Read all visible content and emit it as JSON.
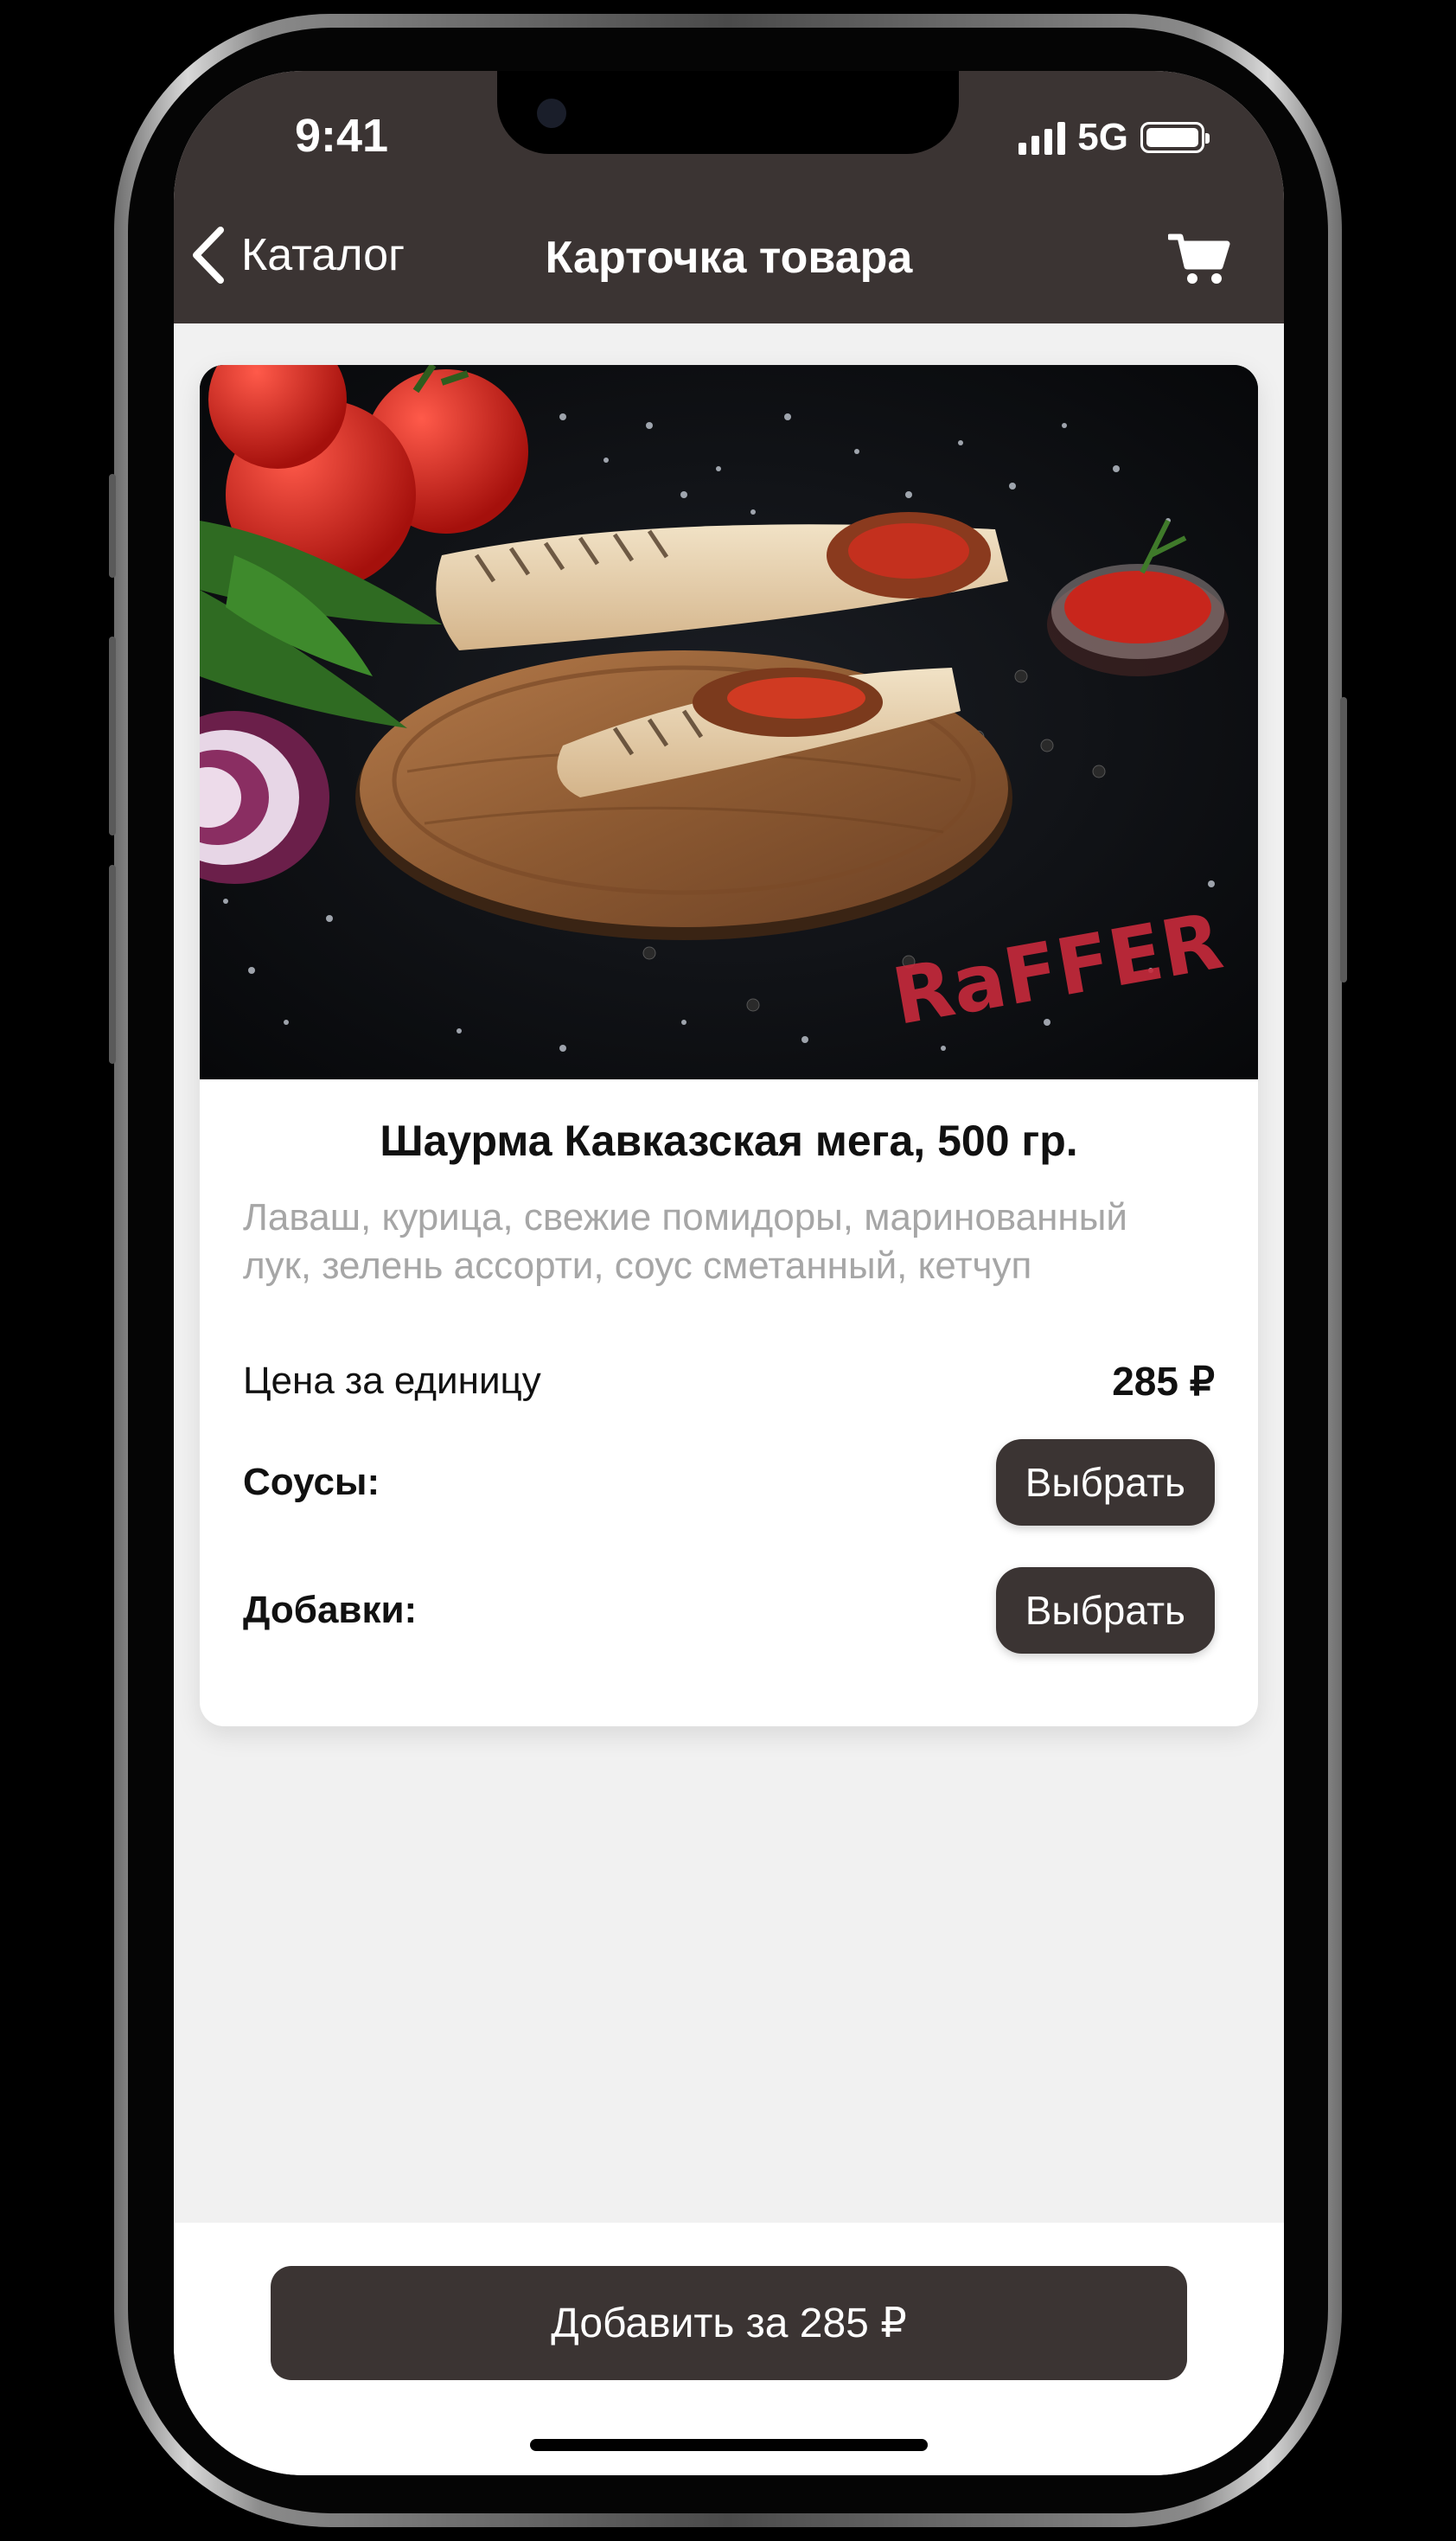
{
  "status_bar": {
    "time": "9:41",
    "network": "5G"
  },
  "nav": {
    "back_label": "Каталог",
    "title": "Карточка товара"
  },
  "product": {
    "image_label": "RaFFER",
    "title": "Шаурма Кавказская мега, 500 гр.",
    "description": "Лаваш, курица, свежие помидоры, маринованный лук, зелень ассорти, соус сметанный, кетчуп",
    "price_label": "Цена за единицу",
    "price": "285 ₽",
    "sauces_label": "Соусы:",
    "sauces_button": "Выбрать",
    "additions_label": "Добавки:",
    "additions_button": "Выбрать"
  },
  "footer": {
    "add_button": "Добавить за 285 ₽"
  },
  "colors": {
    "header": "#3b3433",
    "button": "#3b3433",
    "background": "#f1f1f1"
  }
}
